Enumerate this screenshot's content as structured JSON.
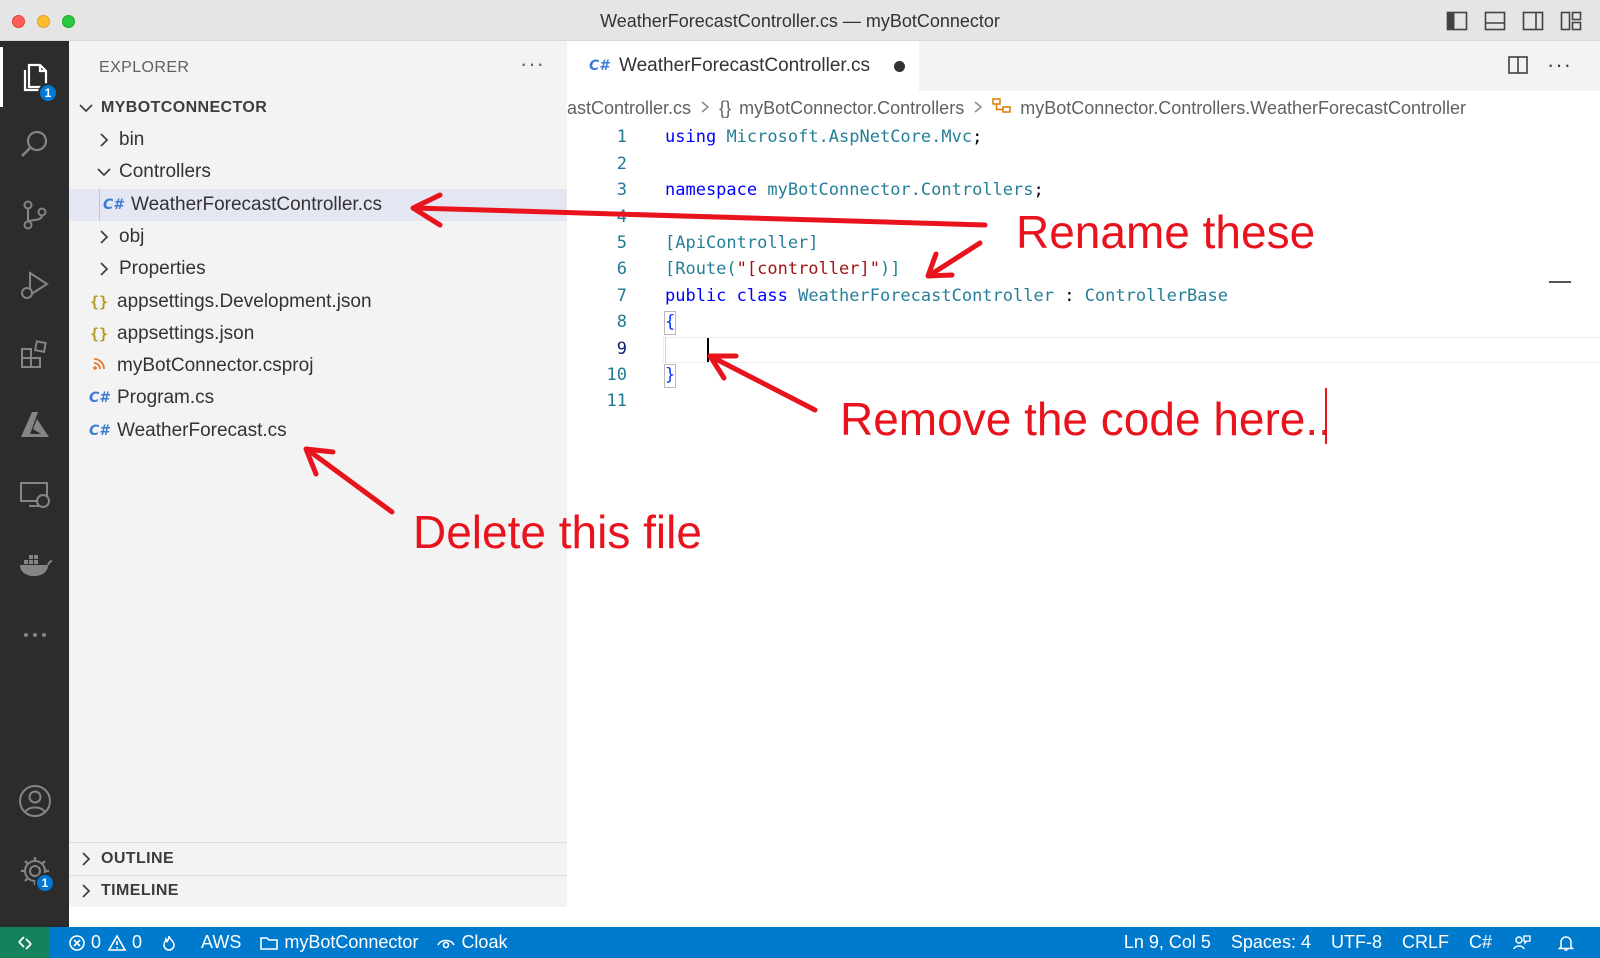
{
  "window": {
    "title": "WeatherForecastController.cs — myBotConnector"
  },
  "activity_bar": {
    "explorer_badge": "1",
    "settings_badge": "1"
  },
  "explorer": {
    "header": "EXPLORER",
    "more": "···",
    "project": "MYBOTCONNECTOR",
    "items": [
      {
        "label": "bin"
      },
      {
        "label": "Controllers"
      },
      {
        "label": "WeatherForecastController.cs",
        "icon": "C#"
      },
      {
        "label": "obj"
      },
      {
        "label": "Properties"
      },
      {
        "label": "appsettings.Development.json",
        "icon": "{}"
      },
      {
        "label": "appsettings.json",
        "icon": "{}"
      },
      {
        "label": "myBotConnector.csproj"
      },
      {
        "label": "Program.cs",
        "icon": "C#"
      },
      {
        "label": "WeatherForecast.cs",
        "icon": "C#"
      }
    ],
    "outline": "OUTLINE",
    "timeline": "TIMELINE"
  },
  "editor": {
    "tab_label": "WeatherForecastController.cs",
    "tab_icon": "C#",
    "more": "···",
    "breadcrumb": {
      "file": "astController.cs",
      "ns_icon": "{}",
      "ns": "myBotConnector.Controllers",
      "cls": "myBotConnector.Controllers.WeatherForecastController"
    },
    "line_numbers": [
      "1",
      "2",
      "3",
      "4",
      "5",
      "6",
      "7",
      "8",
      "9",
      "10",
      "11"
    ],
    "code": {
      "l1_kw": "using",
      "l1_ns": "Microsoft.AspNetCore.Mvc",
      "l1_end": ";",
      "l3_kw": "namespace",
      "l3_ns": "myBotConnector.Controllers",
      "l3_end": ";",
      "l5": "[ApiController]",
      "l6_a": "[Route(",
      "l6_str": "\"[controller]\"",
      "l6_b": ")]",
      "l7_kw": "public class",
      "l7_cls": "WeatherForecastController",
      "l7_colon": ":",
      "l7_base": "ControllerBase",
      "l8": "{",
      "l10": "}"
    }
  },
  "annotations": {
    "rename": "Rename these",
    "remove": "Remove the code here..",
    "delete": "Delete this file"
  },
  "status_bar": {
    "errors": "0",
    "warnings": "0",
    "aws": "AWS",
    "folder": "myBotConnector",
    "cloak": "Cloak",
    "position": "Ln 9, Col 5",
    "spaces": "Spaces: 4",
    "encoding": "UTF-8",
    "eol": "CRLF",
    "language": "C#"
  },
  "colors": {
    "accent": "#007acc",
    "annotation": "#e8131c",
    "activity_bar": "#2c2c2c",
    "sidebar": "#f3f3f3"
  }
}
